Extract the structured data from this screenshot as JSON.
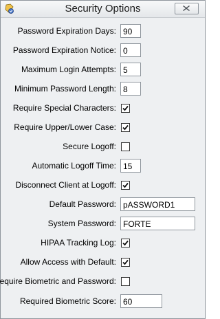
{
  "window": {
    "title": "Security Options"
  },
  "fields": [
    {
      "label": "Password Expiration Days:",
      "type": "text",
      "value": "90"
    },
    {
      "label": "Password Expiration Notice:",
      "type": "text",
      "value": "0"
    },
    {
      "label": "Maximum Login Attempts:",
      "type": "text",
      "value": "5"
    },
    {
      "label": "Minimum Password Length:",
      "type": "text",
      "value": "8"
    },
    {
      "label": "Require Special Characters:",
      "type": "checkbox",
      "checked": true
    },
    {
      "label": "Require Upper/Lower Case:",
      "type": "checkbox",
      "checked": true
    },
    {
      "label": "Secure Logoff:",
      "type": "checkbox",
      "checked": false
    },
    {
      "label": "Automatic Logoff Time:",
      "type": "text",
      "value": "15"
    },
    {
      "label": "Disconnect Client at Logoff:",
      "type": "checkbox",
      "checked": true
    },
    {
      "label": "Default Password:",
      "type": "text",
      "value": "pASSWORD1"
    },
    {
      "label": "System Password:",
      "type": "text",
      "value": "FORTE"
    },
    {
      "label": "HIPAA Tracking Log:",
      "type": "checkbox",
      "checked": true
    },
    {
      "label": "Allow Access with Default:",
      "type": "checkbox",
      "checked": true
    },
    {
      "label": "Require Biometric and Password:",
      "type": "checkbox",
      "checked": false
    },
    {
      "label": "Required Biometric Score:",
      "type": "text",
      "value": "60"
    }
  ],
  "icons": {
    "app": "app-shield-icon",
    "close": "close-icon"
  }
}
